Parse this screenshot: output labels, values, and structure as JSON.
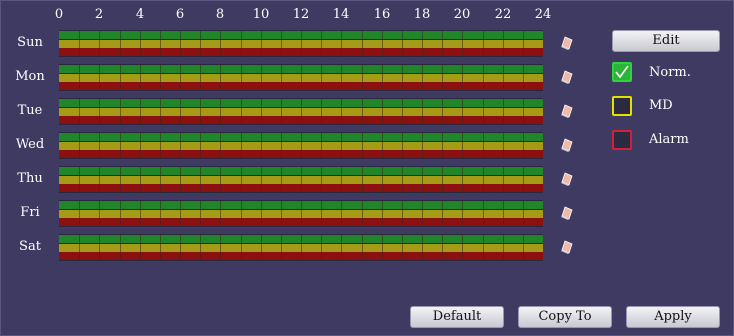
{
  "timeline": {
    "hours": [
      "0",
      "2",
      "4",
      "6",
      "8",
      "10",
      "12",
      "14",
      "16",
      "18",
      "20",
      "22",
      "24"
    ]
  },
  "days": [
    {
      "label": "Sun"
    },
    {
      "label": "Mon"
    },
    {
      "label": "Tue"
    },
    {
      "label": "Wed"
    },
    {
      "label": "Thu"
    },
    {
      "label": "Fri"
    },
    {
      "label": "Sat"
    }
  ],
  "record_types": {
    "normal": {
      "color": "#21862a"
    },
    "md": {
      "color": "#a59b16"
    },
    "alarm": {
      "color": "#8c1010"
    }
  },
  "legend": {
    "edit_label": "Edit",
    "items": [
      {
        "label": "Norm.",
        "border_color": "#2fd43a",
        "checked": true
      },
      {
        "label": "MD",
        "border_color": "#e6e000",
        "checked": false
      },
      {
        "label": "Alarm",
        "border_color": "#d0203a",
        "checked": false
      }
    ]
  },
  "footer": {
    "default_label": "Default",
    "copy_label": "Copy To",
    "apply_label": "Apply"
  },
  "icons": {
    "eraser": "eraser-icon",
    "check": "check-icon"
  }
}
